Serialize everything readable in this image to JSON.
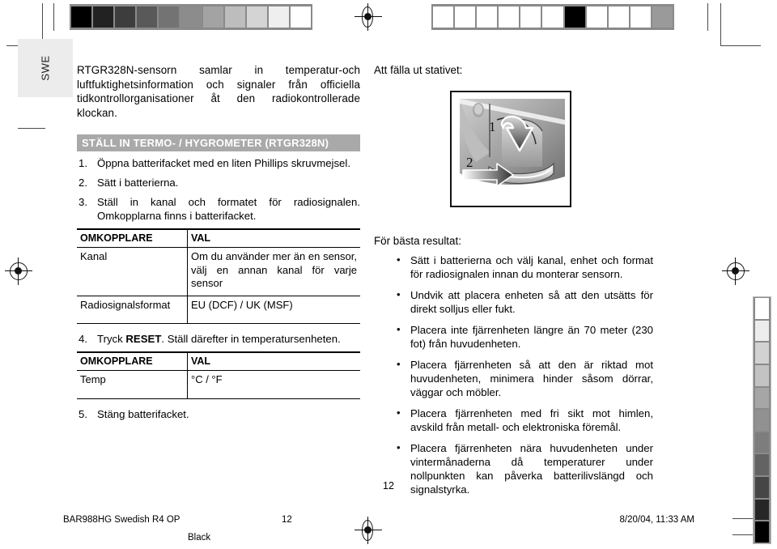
{
  "language_tab": {
    "label": "SWE"
  },
  "left_column": {
    "intro": "RTGR328N-sensorn samlar in temperatur-och luftfuktighetsinformation och signaler från officiella tidkontrollorganisationer åt den radiokontrollerade klockan.",
    "section_header": "STÄLL IN TERMO- / HYGROMETER (RTGR328N)",
    "steps": [
      {
        "num": "1.",
        "text": "Öppna batterifacket med en liten Phillips skruvmejsel."
      },
      {
        "num": "2.",
        "text": "Sätt i batterierna."
      },
      {
        "num": "3.",
        "text": "Ställ in kanal och formatet för radiosignalen. Omkopplarna finns i batterifacket."
      }
    ],
    "table1": {
      "headers": [
        "OMKOPPLARE",
        "VAL"
      ],
      "rows": [
        [
          "Kanal",
          "Om du använder mer än en sensor, välj en annan kanal för varje sensor"
        ],
        [
          "Radiosignalsformat",
          "EU (DCF) / UK (MSF)"
        ]
      ]
    },
    "step4": {
      "num": "4.",
      "pre": "Tryck ",
      "bold": "RESET",
      "post": ". Ställ därefter in temperatursenheten."
    },
    "table2": {
      "headers": [
        "OMKOPPLARE",
        "VAL"
      ],
      "rows": [
        [
          "Temp",
          "°C / °F"
        ]
      ]
    },
    "step5": {
      "num": "5.",
      "text": "Stäng batterifacket."
    }
  },
  "right_column": {
    "heading": "Att fälla ut stativet:",
    "figure": {
      "label_1": "1",
      "label_2": "2"
    },
    "tips_heading": "För bästa resultat:",
    "tips": [
      "Sätt i batterierna och välj kanal, enhet och format för radiosignalen innan du monterar sensorn.",
      "Undvik att placera enheten så att den utsätts för direkt solljus eller fukt.",
      "Placera inte fjärrenheten längre än 70  meter (230 fot) från huvudenheten.",
      "Placera fjärrenheten så att den är riktad mot huvudenheten, minimera hinder såsom dörrar, väggar och möbler.",
      "Placera fjärrenheten med fri sikt mot himlen, avskild från metall- och elektroniska föremål.",
      "Placera fjärrenheten nära huvudenheten under vintermånaderna då temperaturer under nollpunkten kan påverka batterilivslängd och signalstyrka."
    ]
  },
  "footer": {
    "page_number": "12",
    "file": "BAR988HG Swedish R4 OP",
    "page": "12",
    "date": "8/20/04, 11:33 AM",
    "color_plate": "Black"
  },
  "print_marks": {
    "wedge_left_colors": [
      "#000000",
      "#222222",
      "#3d3d3d",
      "#595959",
      "#737373",
      "#8c8c8c",
      "#a3a3a3",
      "#bdbdbd",
      "#d4d4d4",
      "#efefef",
      "#ffffff"
    ],
    "wedge_right_colors": [
      "#ffffff",
      "#ffffff",
      "#ffffff",
      "#ffffff",
      "#ffffff",
      "#ffffff",
      "#000000",
      "#ffffff",
      "#ffffff",
      "#ffffff",
      "#9a9a9a"
    ],
    "wedge_vert_colors": [
      "#ffffff",
      "#ececec",
      "#d2d2d2",
      "#c2c2c2",
      "#a6a6a6",
      "#919191",
      "#7d7d7d",
      "#636363",
      "#464646",
      "#262626",
      "#000000"
    ]
  }
}
